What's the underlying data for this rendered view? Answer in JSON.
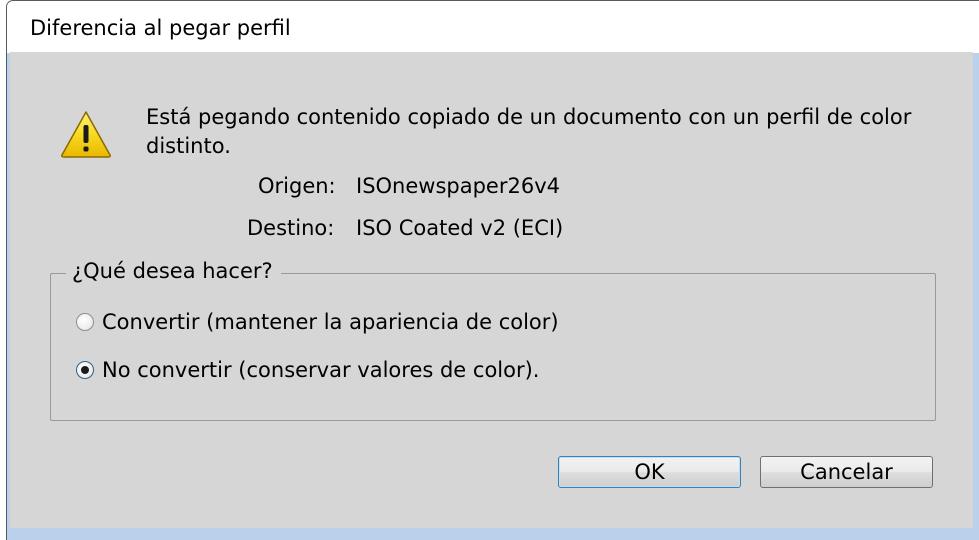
{
  "window": {
    "title": "Diferencia al pegar perfil"
  },
  "message": {
    "text": "Está pegando contenido copiado de un documento con un perfil de color distinto.",
    "icon": "warning-icon"
  },
  "profiles": {
    "source_label": "Origen:",
    "source_value": "ISOnewspaper26v4",
    "destination_label": "Destino:",
    "destination_value": "ISO Coated v2 (ECI)"
  },
  "options": {
    "legend": "¿Qué desea hacer?",
    "items": [
      {
        "label": "Convertir (mantener la apariencia de color)",
        "checked": false
      },
      {
        "label": "No convertir (conservar valores de color).",
        "checked": true
      }
    ]
  },
  "buttons": {
    "ok_label": "OK",
    "cancel_label": "Cancelar"
  },
  "colors": {
    "dialog_background": "#d6d6d6",
    "window_frame": "#b9d1ea",
    "warning_yellow": "#f5d40f"
  }
}
